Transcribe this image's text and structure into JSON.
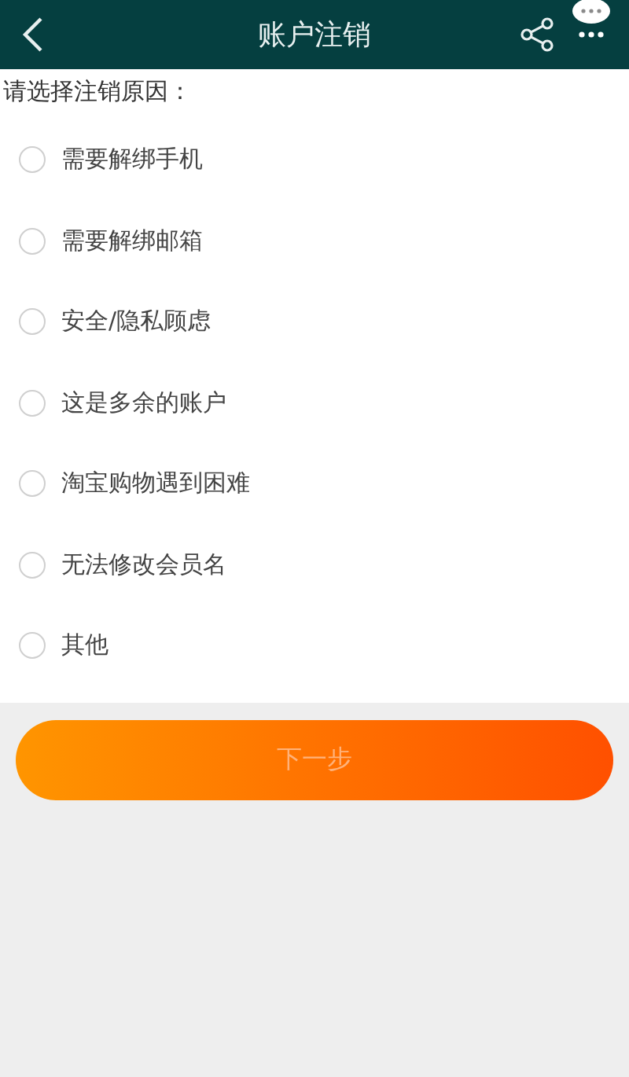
{
  "header": {
    "title": "账户注销"
  },
  "prompt": "请选择注销原因：",
  "reasons": [
    {
      "label": "需要解绑手机",
      "selected": false
    },
    {
      "label": "需要解绑邮箱",
      "selected": false
    },
    {
      "label": "安全/隐私顾虑",
      "selected": false
    },
    {
      "label": "这是多余的账户",
      "selected": false
    },
    {
      "label": "淘宝购物遇到困难",
      "selected": false
    },
    {
      "label": "无法修改会员名",
      "selected": false
    },
    {
      "label": "其他",
      "selected": false
    }
  ],
  "next_button": {
    "label": "下一步",
    "disabled": true
  }
}
